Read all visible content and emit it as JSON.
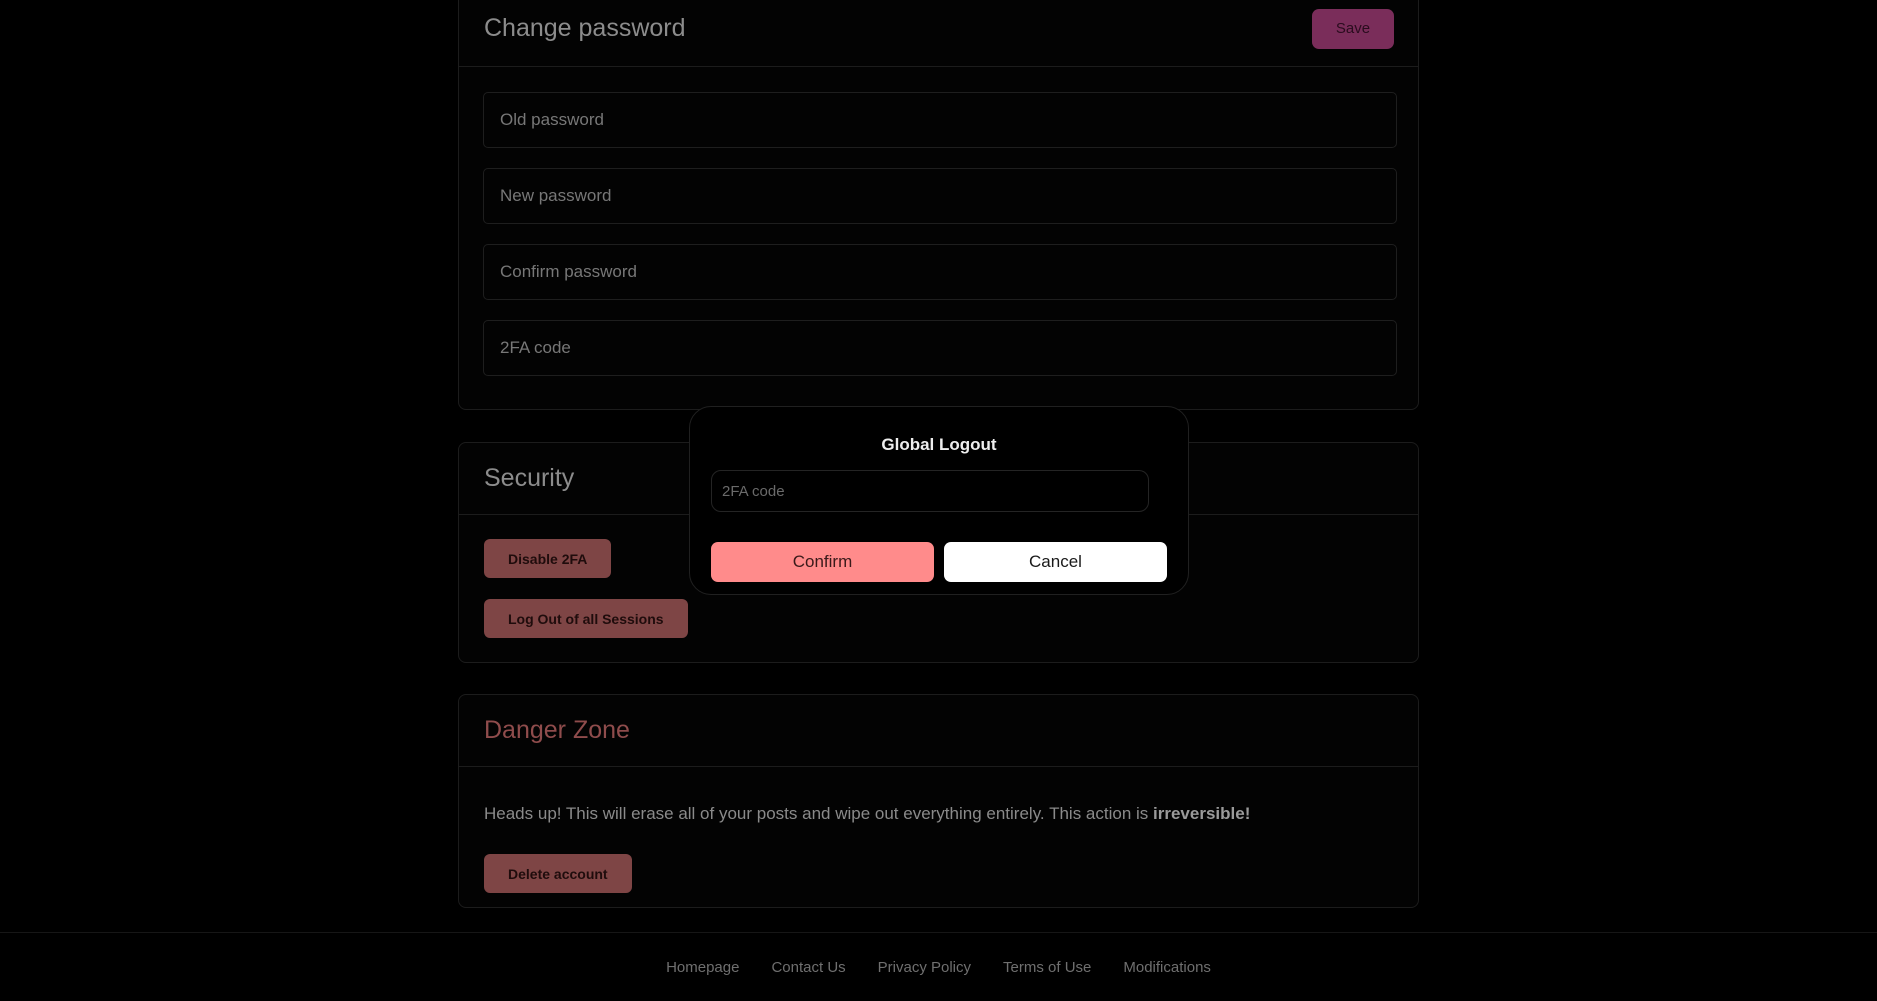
{
  "password_card": {
    "title": "Change password",
    "save_label": "Save",
    "inputs": [
      {
        "placeholder": "Old password",
        "value": ""
      },
      {
        "placeholder": "New password",
        "value": ""
      },
      {
        "placeholder": "Confirm password",
        "value": ""
      },
      {
        "placeholder": "2FA code",
        "value": ""
      }
    ]
  },
  "security_card": {
    "title": "Security",
    "disable_2fa_label": "Disable 2FA",
    "logout_all_label": "Log Out of all Sessions"
  },
  "danger_card": {
    "title": "Danger Zone",
    "warning_text": "Heads up! This will erase all of your posts and wipe out everything entirely. This action is ",
    "warning_emphasis": "irreversible!",
    "delete_label": "Delete account"
  },
  "modal": {
    "title": "Global Logout",
    "input_placeholder": "2FA code",
    "input_value": "",
    "confirm_label": "Confirm",
    "cancel_label": "Cancel"
  },
  "footer": {
    "links": [
      "Homepage",
      "Contact Us",
      "Privacy Policy",
      "Terms of Use",
      "Modifications"
    ]
  },
  "colors": {
    "background": "#000000",
    "save_button": "#7a2d5a",
    "danger_button": "#7e4545",
    "danger_title": "#8f4c4c",
    "confirm_button": "#ff8b8b",
    "cancel_button": "#ffffff"
  }
}
